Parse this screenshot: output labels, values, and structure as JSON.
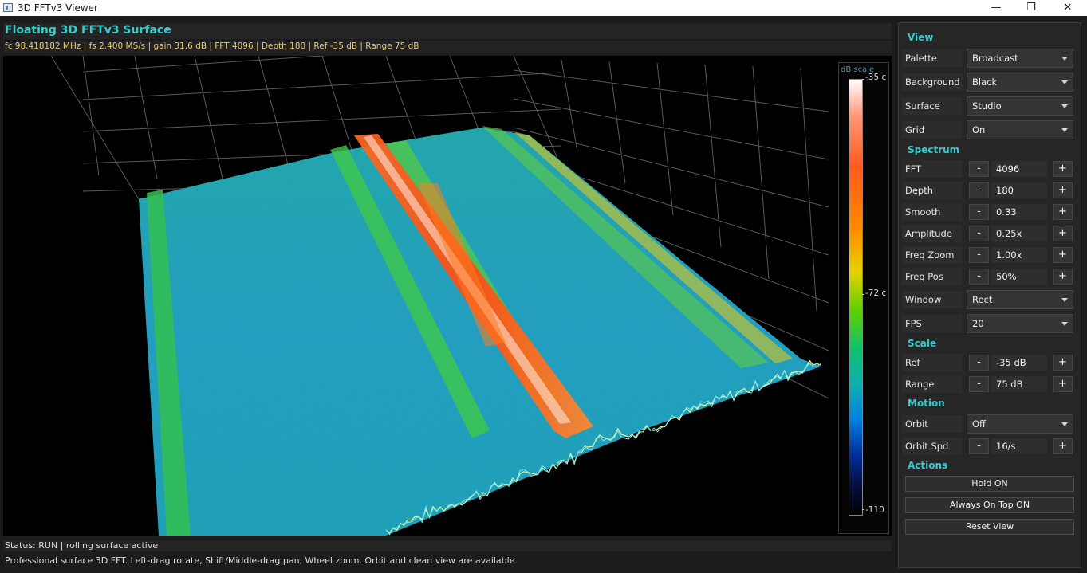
{
  "window": {
    "title": "3D FFTv3 Viewer",
    "minimize_glyph": "—",
    "maximize_glyph": "❐",
    "close_glyph": "✕"
  },
  "header": {
    "title": "Floating 3D FFTv3 Surface",
    "info": "fc 98.418182 MHz | fs 2.400 MS/s | gain 31.6 dB | FFT 4096 | Depth 180 | Ref -35 dB | Range 75 dB"
  },
  "scale": {
    "title": "dB scale",
    "top": "-35 c",
    "mid": "-72 c",
    "bottom": "-110"
  },
  "status": {
    "text": "Status: RUN | rolling surface active",
    "help": "Professional surface 3D FFT. Left-drag rotate, Shift/Middle-drag pan, Wheel zoom. Orbit and clean view are available."
  },
  "panel": {
    "view_title": "View",
    "palette": {
      "label": "Palette",
      "value": "Broadcast"
    },
    "background": {
      "label": "Background",
      "value": "Black"
    },
    "surface": {
      "label": "Surface",
      "value": "Studio"
    },
    "grid": {
      "label": "Grid",
      "value": "On"
    },
    "spectrum_title": "Spectrum",
    "fft": {
      "label": "FFT",
      "value": "4096"
    },
    "depth": {
      "label": "Depth",
      "value": "180"
    },
    "smooth": {
      "label": "Smooth",
      "value": "0.33"
    },
    "amplitude": {
      "label": "Amplitude",
      "value": "0.25x"
    },
    "freq_zoom": {
      "label": "Freq Zoom",
      "value": "1.00x"
    },
    "freq_pos": {
      "label": "Freq Pos",
      "value": "50%"
    },
    "window": {
      "label": "Window",
      "value": "Rect"
    },
    "fps": {
      "label": "FPS",
      "value": "20"
    },
    "scale_title": "Scale",
    "ref": {
      "label": "Ref",
      "value": "-35 dB"
    },
    "range": {
      "label": "Range",
      "value": "75 dB"
    },
    "motion_title": "Motion",
    "orbit": {
      "label": "Orbit",
      "value": "Off"
    },
    "orbit_spd": {
      "label": "Orbit Spd",
      "value": "16/s"
    },
    "actions_title": "Actions",
    "hold_button": "Hold ON",
    "always_on_top_button": "Always On Top ON",
    "reset_view_button": "Reset View",
    "minus": "-",
    "plus": "+"
  }
}
